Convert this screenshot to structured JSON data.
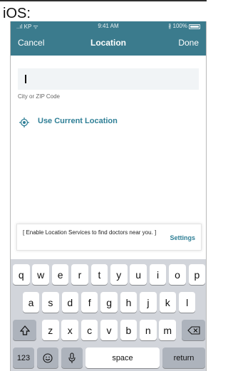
{
  "caption": "iOS:",
  "status_bar": {
    "carrier": "..ıl KP ᯤ",
    "time": "9:41 AM",
    "battery": "∦ 100%",
    "battery_level": 1.0
  },
  "nav": {
    "cancel": "Cancel",
    "title": "Location",
    "done": "Done"
  },
  "location_input": {
    "value": "",
    "placeholder": "",
    "label": "City or ZIP Code"
  },
  "use_current_location": {
    "label": "Use Current Location",
    "icon": "location-target-icon"
  },
  "toast": {
    "message": "[ Enable Location Services to find doctors near you. ]",
    "action": "Settings"
  },
  "keyboard": {
    "row1": [
      "q",
      "w",
      "e",
      "r",
      "t",
      "y",
      "u",
      "i",
      "o",
      "p"
    ],
    "row2": [
      "a",
      "s",
      "d",
      "f",
      "g",
      "h",
      "j",
      "k",
      "l"
    ],
    "row3": [
      "z",
      "x",
      "c",
      "v",
      "b",
      "n",
      "m"
    ],
    "numbers_key": "123",
    "space_key": "space",
    "return_key": "return",
    "icons": [
      "shift-icon",
      "backspace-icon",
      "emoji-icon",
      "microphone-icon"
    ]
  },
  "colors": {
    "nav_bg": "#3b7b8d",
    "accent": "#2f7f96",
    "keyboard_bg": "#d2d5db",
    "input_bg": "#f1f4f6"
  }
}
